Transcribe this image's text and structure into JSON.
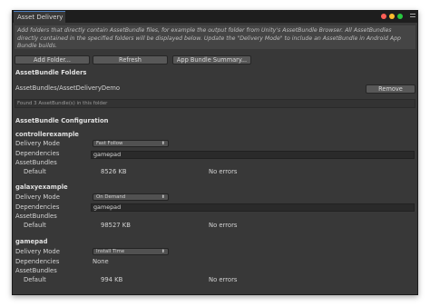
{
  "window": {
    "tab_title": "Asset Delivery",
    "info_text": "Add folders that directly contain AssetBundle files, for example the output folder from Unity's AssetBundle Browser. All AssetBundles directly contained in the specified folders will be displayed below. Update the \"Delivery Mode\" to include an AssetBundle in Android App Bundle builds.",
    "colors": {
      "close": "#ff5f57",
      "minimize": "#febc2e",
      "maximize": "#28c840",
      "accent": "#4d80c4"
    }
  },
  "toolbar": {
    "add_folder": "Add Folder...",
    "refresh": "Refresh",
    "summary": "App Bundle Summary..."
  },
  "folders": {
    "heading": "AssetBundle Folders",
    "path": "AssetBundles/AssetDeliveryDemo",
    "remove": "Remove",
    "status": "Found 3 AssetBundle(s) in this folder"
  },
  "config": {
    "heading": "AssetBundle Configuration",
    "labels": {
      "delivery_mode": "Delivery Mode",
      "dependencies": "Dependencies",
      "assetbundles": "AssetBundles",
      "default": "Default"
    },
    "bundles": [
      {
        "name": "controllerexample",
        "delivery_mode": "Fast Follow",
        "dependencies": "gamepad",
        "size": "8526 KB",
        "errors": "No errors"
      },
      {
        "name": "galaxyexample",
        "delivery_mode": "On Demand",
        "dependencies": "gamepad",
        "size": "98527 KB",
        "errors": "No errors"
      },
      {
        "name": "gamepad",
        "delivery_mode": "Install Time",
        "dependencies": "None",
        "size": "994 KB",
        "errors": "No errors"
      }
    ]
  }
}
